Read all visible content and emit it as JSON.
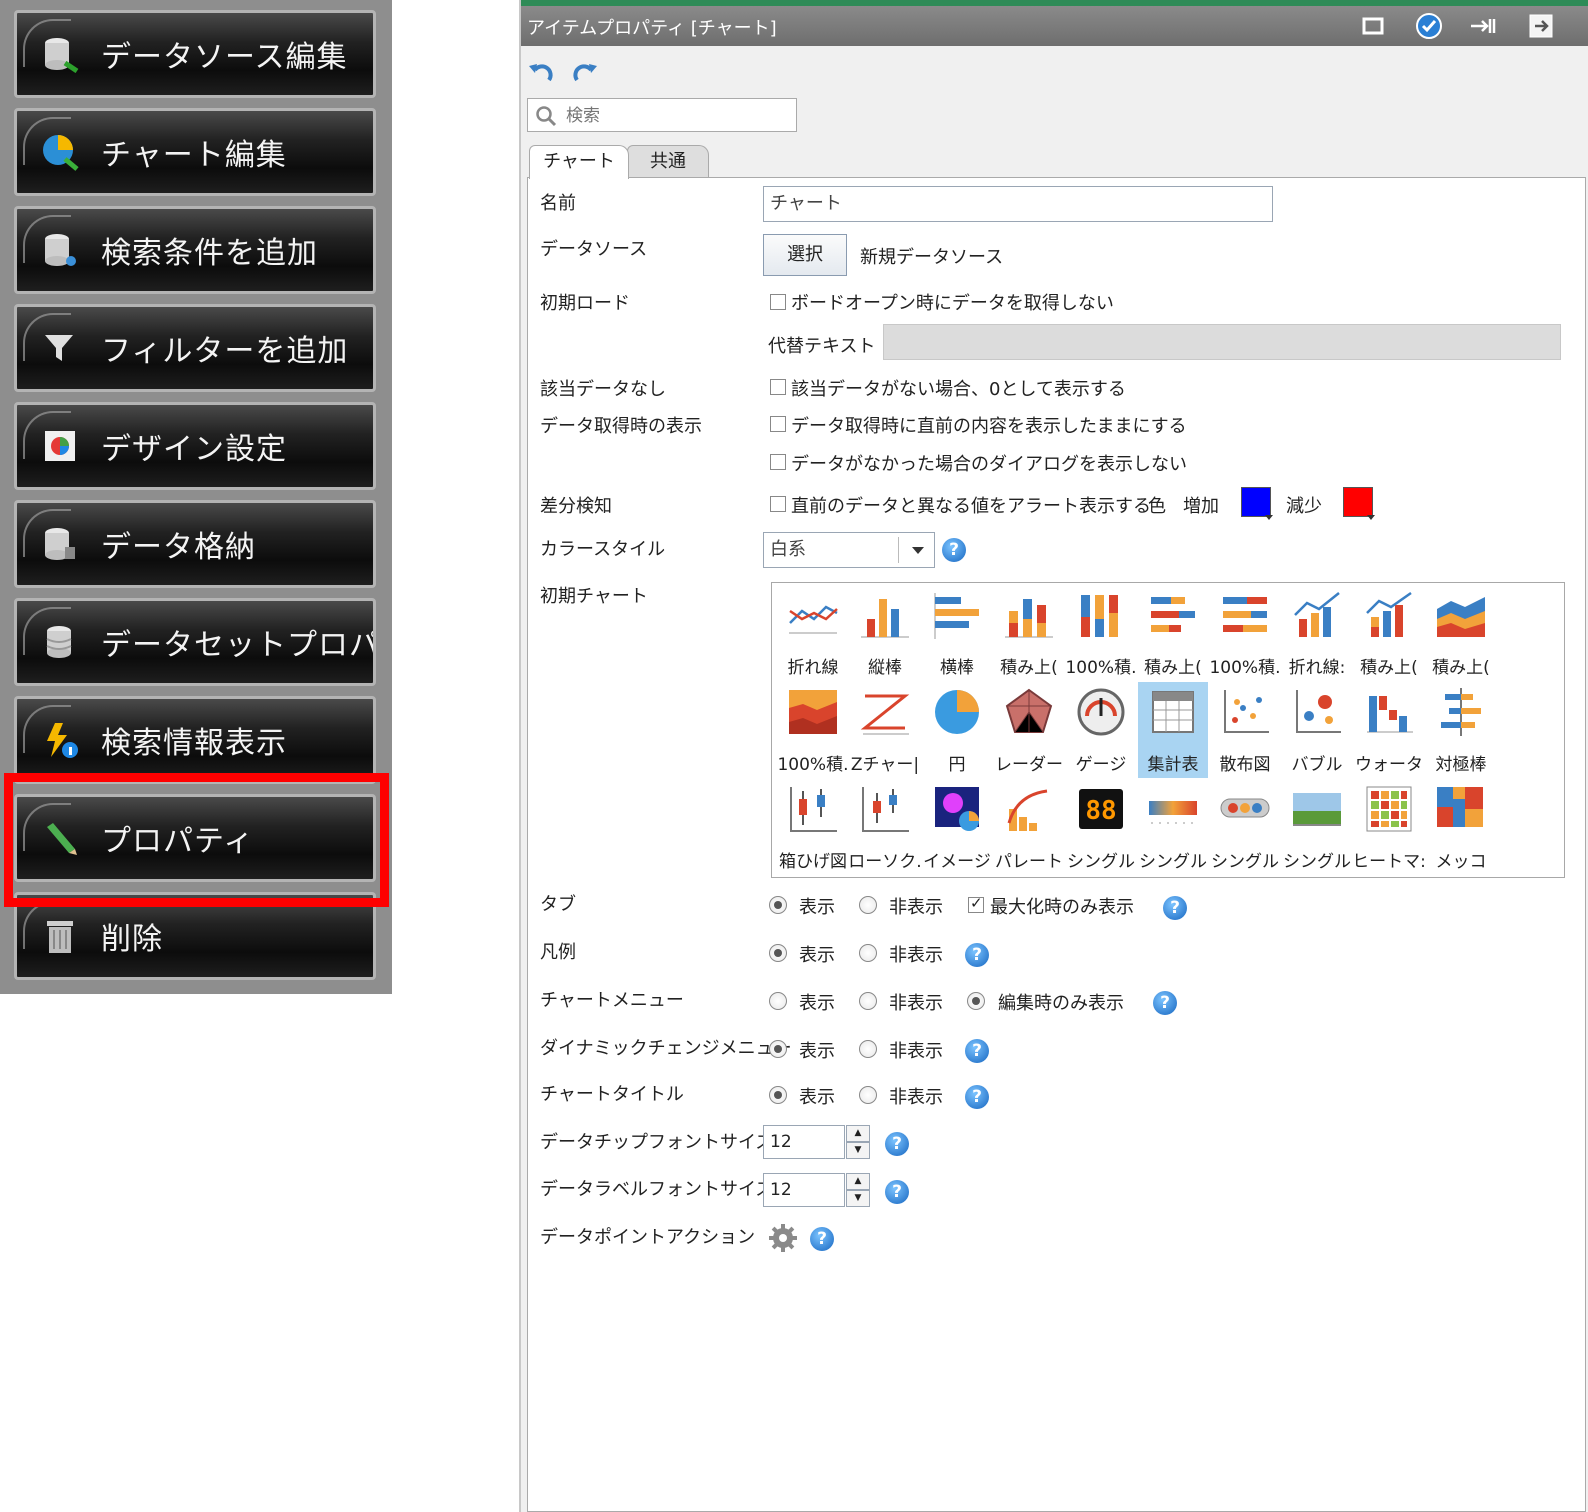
{
  "left_menu": {
    "items": [
      {
        "label": "データソース編集",
        "icon": "database-edit-icon"
      },
      {
        "label": "チャート編集",
        "icon": "chart-edit-icon"
      },
      {
        "label": "検索条件を追加",
        "icon": "database-search-icon"
      },
      {
        "label": "フィルターを追加",
        "icon": "filter-icon"
      },
      {
        "label": "デザイン設定",
        "icon": "design-palette-icon"
      },
      {
        "label": "データ格納",
        "icon": "data-store-icon"
      },
      {
        "label": "データセットプロパティ",
        "icon": "dataset-icon"
      },
      {
        "label": "検索情報表示",
        "icon": "search-info-icon"
      },
      {
        "label": "プロパティ",
        "icon": "pencil-icon",
        "highlighted": true
      },
      {
        "label": "削除",
        "icon": "trash-icon"
      }
    ],
    "highlight_color": "#ff0000"
  },
  "panel": {
    "title": "アイテムプロパティ [チャート]",
    "title_icons": [
      "maximize-icon",
      "apply-check-icon",
      "pin-icon",
      "exit-icon"
    ],
    "search_placeholder": "検索",
    "tabs": [
      "チャート",
      "共通"
    ],
    "active_tab": "チャート",
    "accent_color": "#2e8b57"
  },
  "form": {
    "name": {
      "label": "名前",
      "value": "チャート"
    },
    "datasource": {
      "label": "データソース",
      "button": "選択",
      "value": "新規データソース"
    },
    "initial_load": {
      "label": "初期ロード",
      "checkbox": "ボードオープン時にデータを取得しない",
      "alt_text_label": "代替テキスト"
    },
    "no_data": {
      "label": "該当データなし",
      "checkbox": "該当データがない場合、0として表示する"
    },
    "fetch_display": {
      "label": "データ取得時の表示",
      "checkbox1": "データ取得時に直前の内容を表示したままにする",
      "checkbox2": "データがなかった場合のダイアログを表示しない"
    },
    "diff": {
      "label": "差分検知",
      "checkbox": "直前のデータと異なる値をアラート表示する",
      "color_label": "色",
      "increase_label": "増加",
      "increase_color": "#0000ff",
      "decrease_label": "減少",
      "decrease_color": "#ff0000"
    },
    "color_style": {
      "label": "カラースタイル",
      "value": "白系"
    },
    "initial_chart": {
      "label": "初期チャート",
      "selected": "集計表",
      "items": [
        "折れ線",
        "縦棒",
        "横棒",
        "積み上(",
        "100%積.",
        "積み上(",
        "100%積.",
        "折れ線:",
        "積み上(",
        "積み上(",
        "100%積.",
        "Zチャー|",
        "円",
        "レーダー",
        "ゲージ",
        "集計表",
        "散布図",
        "バブル",
        "ウォータ",
        "対極棒",
        "箱ひげ図",
        "ローソク.",
        "イメージ",
        "パレート",
        "シングル",
        "シングル",
        "シングル",
        "シングル",
        "ヒートマ:",
        "メッコ"
      ]
    },
    "tab_opt": {
      "label": "タブ",
      "show": "表示",
      "hide": "非表示",
      "max_only": "最大化時のみ表示"
    },
    "legend": {
      "label": "凡例",
      "show": "表示",
      "hide": "非表示"
    },
    "chart_menu": {
      "label": "チャートメニュー",
      "show": "表示",
      "hide": "非表示",
      "edit_only": "編集時のみ表示"
    },
    "dynamic_menu": {
      "label": "ダイナミックチェンジメニュー",
      "show": "表示",
      "hide": "非表示"
    },
    "chart_title": {
      "label": "チャートタイトル",
      "show": "表示",
      "hide": "非表示"
    },
    "chip_font": {
      "label": "データチップフォントサイズ",
      "value": "12"
    },
    "label_font": {
      "label": "データラベルフォントサイズ",
      "value": "12"
    },
    "point_action": {
      "label": "データポイントアクション"
    }
  }
}
